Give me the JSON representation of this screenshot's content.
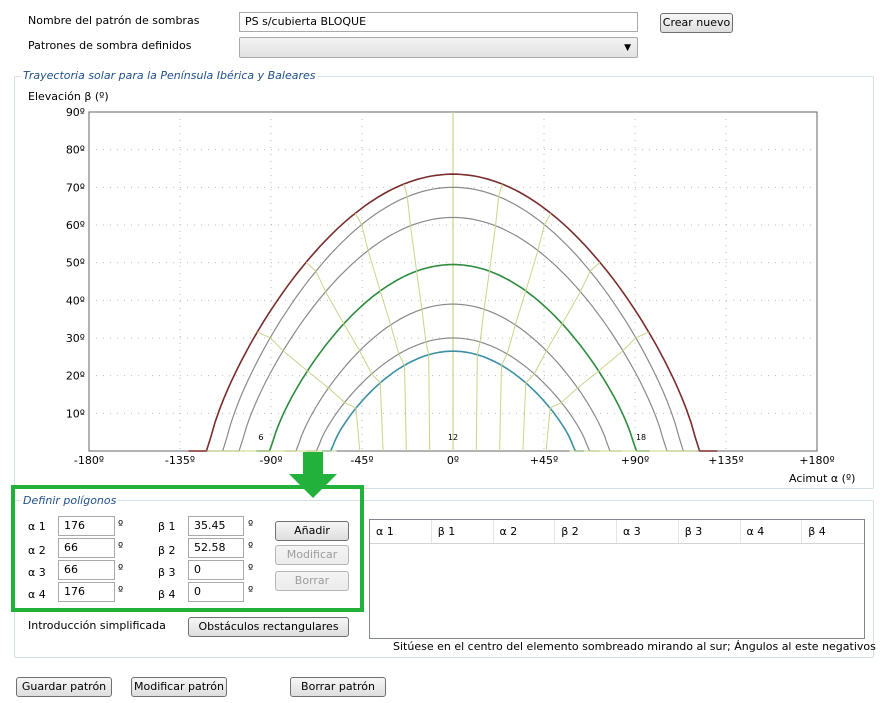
{
  "pattern": {
    "name_label": "Nombre del patrón de sombras",
    "name_value": "PS s/cubierta BLOQUE",
    "create_button": "Crear nuevo",
    "defined_label": "Patrones de sombra definidos",
    "defined_value": ""
  },
  "chart_panel": {
    "legend": "Trayectoria solar para la Península Ibérica y Baleares",
    "y_title": "Elevación β (º)",
    "x_title": "Acimut α (º)"
  },
  "chart_data": {
    "type": "line",
    "title": "Trayectoria solar para la Península Ibérica y Baleares",
    "xlabel": "Acimut α (º)",
    "ylabel": "Elevación β (º)",
    "xlim": [
      -180,
      180
    ],
    "ylim": [
      0,
      90
    ],
    "x_ticks": [
      "-180º",
      "-135º",
      "-90º",
      "-45º",
      "0º",
      "+45º",
      "+90º",
      "+135º",
      "+180º"
    ],
    "y_ticks": [
      "10º",
      "20º",
      "30º",
      "40º",
      "50º",
      "60º",
      "70º",
      "80º",
      "90º"
    ],
    "hour_labels": [
      "6",
      "12",
      "18"
    ],
    "sun_paths": [
      {
        "max_elevation": 73.5,
        "half_width": 121,
        "color": "#7b2c2c"
      },
      {
        "max_elevation": 70,
        "half_width": 113,
        "color": "#8a8a8a"
      },
      {
        "max_elevation": 62,
        "half_width": 105,
        "color": "#8a8a8a"
      },
      {
        "max_elevation": 49.5,
        "half_width": 90,
        "color": "#2e8b3e"
      },
      {
        "max_elevation": 39,
        "half_width": 77,
        "color": "#8a8a8a"
      },
      {
        "max_elevation": 30,
        "half_width": 67,
        "color": "#8a8a8a"
      },
      {
        "max_elevation": 26.5,
        "half_width": 60,
        "color": "#3a8fa3"
      }
    ],
    "colors": {
      "hour_lines": "#c9d48a",
      "frame": "#666666",
      "grid": "#bbbbbb"
    }
  },
  "polygons": {
    "legend": "Definir polígonos",
    "alpha_labels": [
      "α 1",
      "α 2",
      "α 3",
      "α 4"
    ],
    "beta_labels": [
      "β 1",
      "β 2",
      "β 3",
      "β 4"
    ],
    "alpha_values": [
      "176",
      "66",
      "66",
      "176"
    ],
    "beta_values": [
      "35.45",
      "52.58",
      "0",
      "0"
    ],
    "unit": "º",
    "add_button": "Añadir",
    "modify_button": "Modificar",
    "delete_button": "Borrar",
    "simplified_label": "Introducción simplificada",
    "rect_button": "Obstáculos rectangulares",
    "table_headers": [
      "α 1",
      "β 1",
      "α 2",
      "β 2",
      "α 3",
      "β 3",
      "α 4",
      "β 4"
    ],
    "hint": "Sitúese en el centro del elemento sombreado mirando al sur; Ángulos al este negativos"
  },
  "footer": {
    "save": "Guardar patrón",
    "modify": "Modificar patrón",
    "delete": "Borrar patrón"
  },
  "highlight_color": "#22b13a"
}
